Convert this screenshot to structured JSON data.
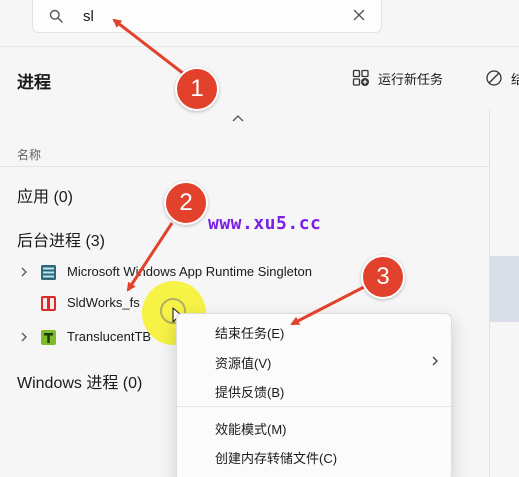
{
  "search": {
    "value": "sl"
  },
  "header": {
    "title": "进程",
    "run_new_task_label": "运行新任务",
    "end_task_label": "结"
  },
  "columns": {
    "name_header": "名称"
  },
  "groups": {
    "apps": "应用 (0)",
    "background": "后台进程 (3)",
    "windows": "Windows 进程 (0)"
  },
  "processes": [
    {
      "name": "Microsoft Windows App Runtime Singleton",
      "icon": "app-runtime-icon",
      "expandable": true
    },
    {
      "name": "SldWorks_fs",
      "icon": "solidworks-icon",
      "expandable": false
    },
    {
      "name": "TranslucentTB",
      "icon": "translucenttb-icon",
      "expandable": true
    }
  ],
  "context_menu": {
    "items": [
      {
        "label": "结束任务(E)"
      },
      {
        "label": "资源值(V)",
        "has_submenu": true
      },
      {
        "label": "提供反馈(B)"
      },
      {
        "label": "效能模式(M)"
      },
      {
        "label": "创建内存转储文件(C)"
      }
    ]
  },
  "watermark": "www.xu5.cc",
  "annotations": {
    "badge_1": "1",
    "badge_2": "2",
    "badge_3": "3"
  },
  "colors": {
    "badge": "#e2412c",
    "watermark": "#7a1fe8",
    "highlight": "#f5f01e"
  }
}
